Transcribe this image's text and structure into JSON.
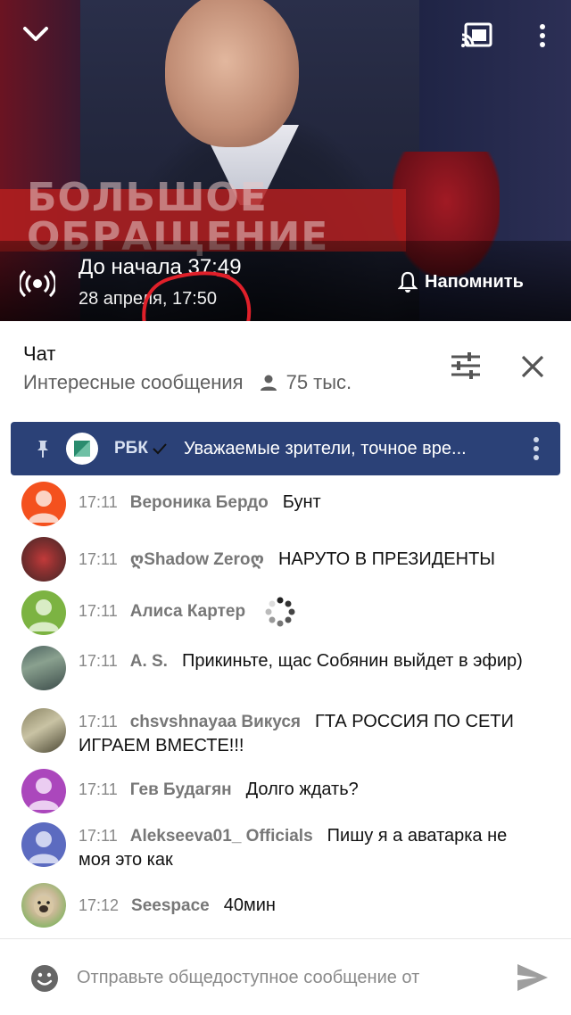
{
  "video": {
    "banner_text": "БОЛЬШОЕ ОБРАЩЕНИЕ",
    "countdown": "До начала 37:49",
    "date": "28 апреля, 17:50",
    "remind_label": "Напомнить"
  },
  "chat": {
    "title": "Чат",
    "subtitle": "Интересные сообщения",
    "viewers": "75 тыс."
  },
  "pinned": {
    "author": "РБК",
    "message": "Уважаемые зрители, точное вре..."
  },
  "messages": [
    {
      "time": "17:11",
      "author": "Вероника Бердо",
      "text": "Бунт",
      "avatar_color": "#f4511e"
    },
    {
      "time": "17:11",
      "author": "ღShadow Zeroღ",
      "text": "НАРУТО В ПРЕЗИДЕНТЫ",
      "avatar_color": "#9c3a3a"
    },
    {
      "time": "17:11",
      "author": "Алиса Картер",
      "text": "",
      "avatar_color": "#7cb342"
    },
    {
      "time": "17:11",
      "author": "A. S.",
      "text": "Прикиньте, щас Собянин выйдет в эфир)",
      "avatar_color": "#5b6f6a"
    },
    {
      "time": "17:11",
      "author": "chsvshnayaa Викуся",
      "text": "ГТА РОССИЯ ПО СЕТИ ИГРАЕМ ВМЕСТЕ!!!",
      "avatar_color": "#6e6a52"
    },
    {
      "time": "17:11",
      "author": "Гев Будагян",
      "text": "Долго ждать?",
      "avatar_color": "#ab47bc"
    },
    {
      "time": "17:11",
      "author": "Alekseeva01_ Officials",
      "text": "Пишу я а аватарка не моя это как",
      "avatar_color": "#5c6bc0"
    },
    {
      "time": "17:12",
      "author": "Seespace",
      "text": "40мин",
      "avatar_color": "#a5d66c"
    }
  ],
  "input": {
    "placeholder": "Отправьте общедоступное сообщение от"
  }
}
